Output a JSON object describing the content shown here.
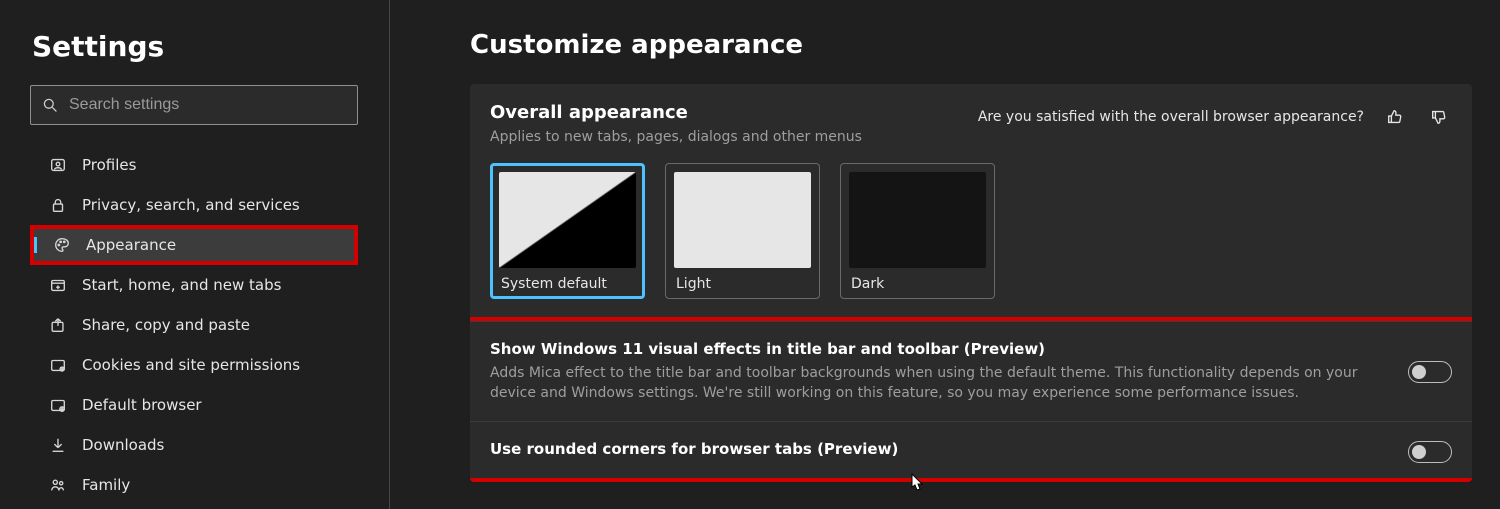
{
  "sidebar": {
    "title": "Settings",
    "search_placeholder": "Search settings",
    "items": [
      {
        "label": "Profiles"
      },
      {
        "label": "Privacy, search, and services"
      },
      {
        "label": "Appearance",
        "active": true
      },
      {
        "label": "Start, home, and new tabs"
      },
      {
        "label": "Share, copy and paste"
      },
      {
        "label": "Cookies and site permissions"
      },
      {
        "label": "Default browser"
      },
      {
        "label": "Downloads"
      },
      {
        "label": "Family"
      }
    ]
  },
  "main": {
    "title": "Customize appearance",
    "section": {
      "title": "Overall appearance",
      "description": "Applies to new tabs, pages, dialogs and other menus",
      "feedback_prompt": "Are you satisfied with the overall browser appearance?"
    },
    "themes": [
      {
        "label": "System default",
        "selected": true
      },
      {
        "label": "Light",
        "selected": false
      },
      {
        "label": "Dark",
        "selected": false
      }
    ],
    "settings": [
      {
        "title": "Show Windows 11 visual effects in title bar and toolbar (Preview)",
        "description": "Adds Mica effect to the title bar and toolbar backgrounds when using the default theme. This functionality depends on your device and Windows settings. We're still working on this feature, so you may experience some performance issues.",
        "enabled": false
      },
      {
        "title": "Use rounded corners for browser tabs (Preview)",
        "description": "",
        "enabled": false
      }
    ]
  }
}
